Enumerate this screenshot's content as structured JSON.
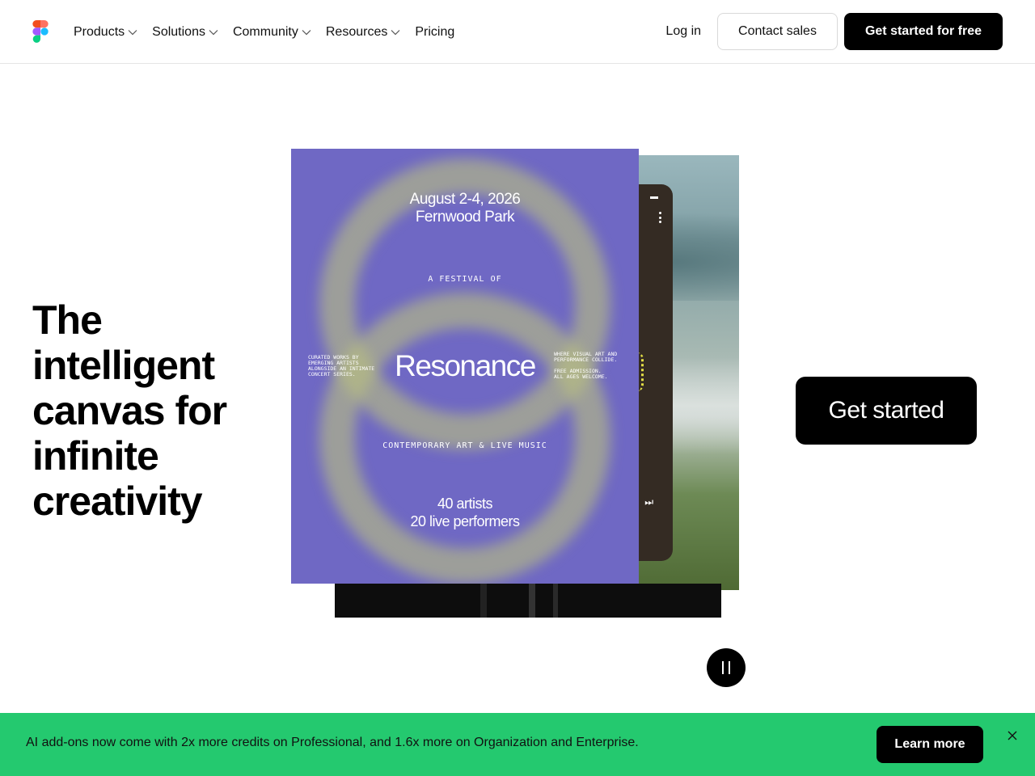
{
  "nav": {
    "logo_icon": "figma-logo-icon",
    "links": [
      {
        "label": "Products",
        "has_dropdown": true
      },
      {
        "label": "Solutions",
        "has_dropdown": true
      },
      {
        "label": "Community",
        "has_dropdown": true
      },
      {
        "label": "Resources",
        "has_dropdown": true
      },
      {
        "label": "Pricing",
        "has_dropdown": false
      }
    ],
    "login_label": "Log in",
    "contact_label": "Contact sales",
    "cta_label": "Get started for free"
  },
  "hero": {
    "headline_lines": [
      "The",
      "intelligent",
      "canvas for",
      "infinite",
      "creativity"
    ],
    "get_started_label": "Get started",
    "pause_icon": "pause-icon"
  },
  "poster": {
    "date_line1": "August 2-4, 2026",
    "date_line2": "Fernwood Park",
    "arc_top": "A FESTIVAL OF",
    "title": "Resonance",
    "side_left": "CURATED WORKS BY\nEMERGING ARTISTS\nALONGSIDE AN INTIMATE\nCONCERT SERIES.",
    "side_right": "WHERE VISUAL ART AND\nPERFORMANCE COLLIDE.\n\nFREE ADMISSION.\nALL AGES WELCOME.",
    "arc_bottom": "CONTEMPORARY ART & LIVE MUSIC",
    "count_line1": "40 artists",
    "count_line2": "20 live performers",
    "colors": {
      "background": "#6f68c4",
      "ring": "#bac080"
    }
  },
  "banner": {
    "text": "AI add-ons now come with 2x more credits on Professional, and 1.6x more on Organization and Enterprise.",
    "learn_label": "Learn more",
    "close_icon": "close-icon",
    "color": "#24c96f"
  }
}
